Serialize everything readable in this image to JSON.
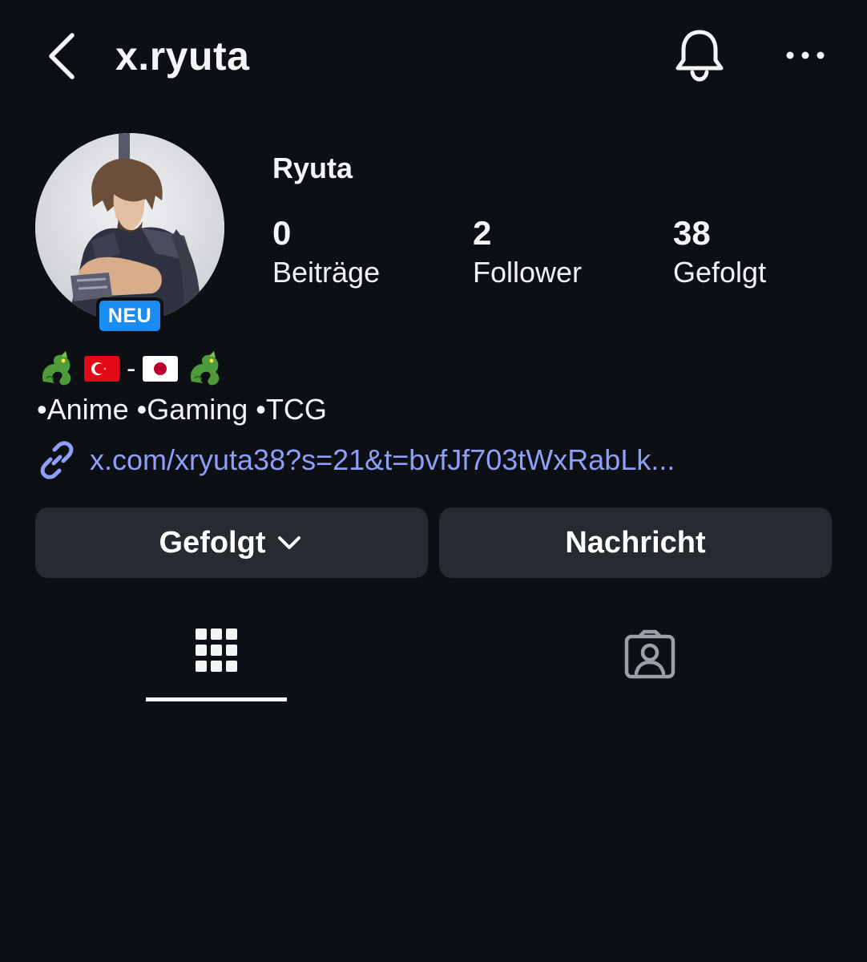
{
  "header": {
    "username": "x.ryuta",
    "back_icon": "chevron-left-icon",
    "notification_icon": "bell-icon",
    "more_icon": "more-horizontal-icon"
  },
  "profile": {
    "display_name": "Ryuta",
    "badge": "NEU",
    "stats": {
      "posts": {
        "value": "0",
        "label": "Beiträge"
      },
      "followers": {
        "value": "2",
        "label": "Follower"
      },
      "following": {
        "value": "38",
        "label": "Gefolgt"
      }
    },
    "bio": {
      "emoji_line": [
        "dragon-emoji",
        "turkey-flag-emoji",
        "-",
        "japan-flag-emoji",
        "dragon-emoji"
      ],
      "dash": "-",
      "text": "•Anime •Gaming •TCG",
      "link": "x.com/xryuta38?s=21&t=bvfJf703tWxRabLk..."
    }
  },
  "actions": {
    "following_label": "Gefolgt",
    "message_label": "Nachricht"
  },
  "tabs": {
    "grid_icon": "grid-icon",
    "tagged_icon": "tagged-person-icon",
    "active": "grid"
  },
  "colors": {
    "background": "#0c1015",
    "button": "#262a31",
    "link": "#8f9ff7",
    "badge": "#1b8df2"
  }
}
